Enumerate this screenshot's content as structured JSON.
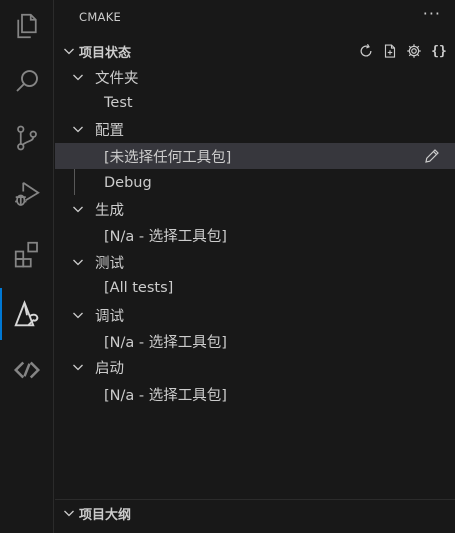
{
  "activity_bar": {
    "items": [
      {
        "icon": "explorer-icon"
      },
      {
        "icon": "search-icon"
      },
      {
        "icon": "source-control-icon"
      },
      {
        "icon": "run-debug-icon"
      },
      {
        "icon": "extensions-icon"
      },
      {
        "icon": "cmake-icon",
        "active": true
      },
      {
        "icon": "remote-icon"
      }
    ]
  },
  "sidebar": {
    "title": "CMAKE",
    "more_label": "···",
    "project_status": {
      "title": "项目状态",
      "actions": [
        "refresh-icon",
        "new-file-icon",
        "gear-icon"
      ],
      "braces_label": "{}",
      "tree": [
        {
          "label": "文件夹",
          "children": [
            "Test"
          ]
        },
        {
          "label": "配置",
          "children": [
            "[未选择任何工具包]",
            "Debug"
          ]
        },
        {
          "label": "生成",
          "children": [
            "[N/a - 选择工具包]"
          ]
        },
        {
          "label": "测试",
          "children": [
            "[All tests]"
          ]
        },
        {
          "label": "调试",
          "children": [
            "[N/a - 选择工具包]"
          ]
        },
        {
          "label": "启动",
          "children": [
            "[N/a - 选择工具包]"
          ]
        }
      ]
    },
    "project_outline": {
      "title": "项目大纲"
    }
  },
  "colors": {
    "background": "#181818",
    "selected_row": "#37373d",
    "active_indicator": "#0078d4",
    "text": "#cccccc",
    "icon": "#c5c5c5"
  }
}
